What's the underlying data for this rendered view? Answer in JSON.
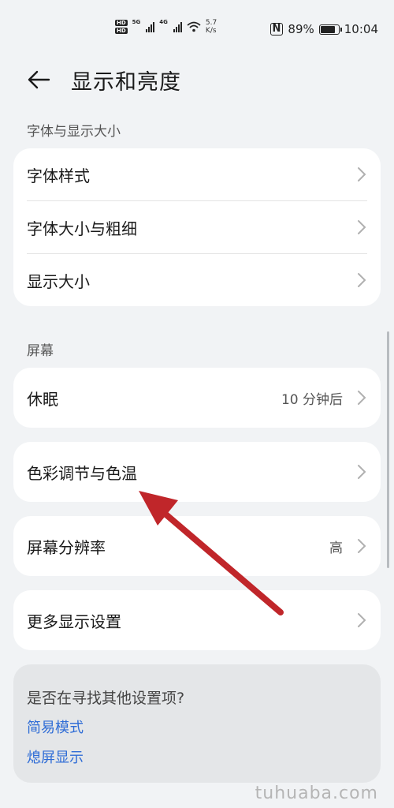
{
  "status_bar": {
    "hd1": "HD",
    "hd2": "HD",
    "net1": "5G",
    "net2": "4G",
    "speed_value": "5.7",
    "speed_unit": "K/s",
    "nfc": "N",
    "battery_percent": "89%",
    "battery_level": 0.89,
    "time": "10:04"
  },
  "header": {
    "title": "显示和亮度"
  },
  "sections": {
    "font_display": {
      "label": "字体与显示大小",
      "items": [
        {
          "label": "字体样式"
        },
        {
          "label": "字体大小与粗细"
        },
        {
          "label": "显示大小"
        }
      ]
    },
    "screen": {
      "label": "屏幕",
      "sleep": {
        "label": "休眠",
        "value": "10 分钟后"
      },
      "color": {
        "label": "色彩调节与色温"
      },
      "resolution": {
        "label": "屏幕分辨率",
        "value": "高"
      },
      "more": {
        "label": "更多显示设置"
      }
    }
  },
  "suggestions": {
    "question": "是否在寻找其他设置项?",
    "links": [
      "简易模式",
      "熄屏显示"
    ]
  },
  "watermark": "tuhuaba.com",
  "colors": {
    "background": "#f1f3f5",
    "card": "#ffffff",
    "link": "#2e6cd6",
    "arrow": "#c0262a"
  }
}
